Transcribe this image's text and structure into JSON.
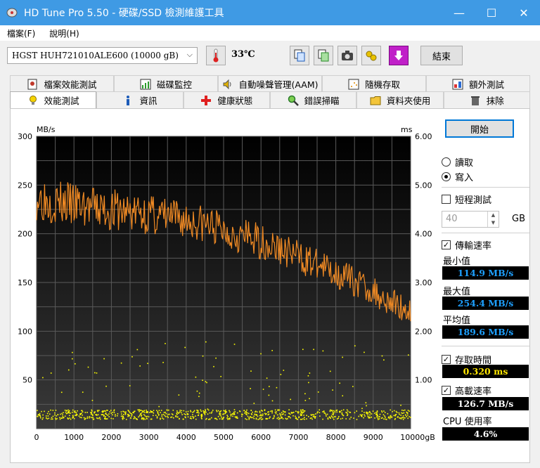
{
  "window": {
    "title": "HD Tune Pro 5.50 - 硬碟/SSD 檢測維護工具",
    "minimize": "—",
    "maximize": "☐",
    "close": "✕"
  },
  "menu": {
    "file": "檔案(F)",
    "help": "說明(H)"
  },
  "toolbar": {
    "drive": "HGST HUH721010ALE600 (10000 gB)",
    "temperature": "33℃",
    "exit": "結束"
  },
  "tabs_top": [
    {
      "label": "檔案效能測試",
      "icon": "file-benchmark-icon"
    },
    {
      "label": "磁碟監控",
      "icon": "disk-monitor-icon"
    },
    {
      "label": "自動噪聲管理(AAM)",
      "icon": "speaker-icon"
    },
    {
      "label": "隨機存取",
      "icon": "random-access-icon"
    },
    {
      "label": "額外測試",
      "icon": "extra-tests-icon"
    }
  ],
  "tabs_bottom": [
    {
      "label": "效能測試",
      "icon": "bulb-icon"
    },
    {
      "label": "資訊",
      "icon": "info-icon"
    },
    {
      "label": "健康狀態",
      "icon": "health-cross-icon"
    },
    {
      "label": "錯誤掃瞄",
      "icon": "magnifier-icon"
    },
    {
      "label": "資料夾使用",
      "icon": "folder-icon"
    },
    {
      "label": "抹除",
      "icon": "trash-icon"
    }
  ],
  "controls": {
    "start": "開始",
    "read": "讀取",
    "write": "寫入",
    "short_test": "短程測試",
    "short_value": "40",
    "gb": "GB",
    "transfer_rate": "傳輸速率",
    "min_label": "最小值",
    "min_value": "114.9 MB/s",
    "max_label": "最大值",
    "max_value": "254.4 MB/s",
    "avg_label": "平均值",
    "avg_value": "189.6 MB/s",
    "access_time": "存取時間",
    "access_value": "0.320 ms",
    "burst_rate": "高載速率",
    "burst_value": "126.7 MB/s",
    "cpu_label": "CPU 使用率",
    "cpu_value": "4.6%"
  },
  "colors": {
    "transfer_line": "#f08a24",
    "access_points": "#ffff00",
    "plot_bg": "#1e1e1e",
    "title_bar": "#3f9ae4"
  },
  "chart_data": {
    "type": "line",
    "y_left_label": "MB/s",
    "y_right_label": "ms",
    "x_unit_label": "gB",
    "x_ticks": [
      "0",
      "1000",
      "2000",
      "3000",
      "4000",
      "5000",
      "6000",
      "7000",
      "8000",
      "9000",
      "10000"
    ],
    "y_left_ticks": [
      "50",
      "100",
      "150",
      "200",
      "250",
      "300"
    ],
    "y_right_ticks": [
      "1.00",
      "2.00",
      "3.00",
      "4.00",
      "5.00",
      "6.00"
    ],
    "xlim": [
      0,
      10000
    ],
    "ylim_left": [
      0,
      300
    ],
    "ylim_right": [
      0,
      6
    ],
    "series": [
      {
        "axis": "left",
        "x": [
          0,
          250,
          500,
          750,
          1000,
          1250,
          1500,
          1750,
          2000,
          2250,
          2500,
          2750,
          3000,
          3250,
          3500,
          3750,
          4000,
          4250,
          4500,
          4750,
          5000,
          5250,
          5500,
          5750,
          6000,
          6250,
          6500,
          6750,
          7000,
          7250,
          7500,
          7750,
          8000,
          8250,
          8500,
          8750,
          9000,
          9250,
          9500,
          9750,
          10000
        ],
        "values": [
          238,
          236,
          233,
          231,
          229,
          228,
          226,
          225,
          224,
          223,
          222,
          221,
          220,
          218,
          217,
          215,
          214,
          212,
          210,
          207,
          204,
          201,
          198,
          195,
          192,
          188,
          184,
          181,
          177,
          172,
          168,
          164,
          160,
          156,
          151,
          146,
          141,
          135,
          130,
          125,
          120
        ]
      }
    ],
    "access_time_band_ms": [
      0.2,
      0.4
    ],
    "access_time_mean_ms": 0.32
  }
}
